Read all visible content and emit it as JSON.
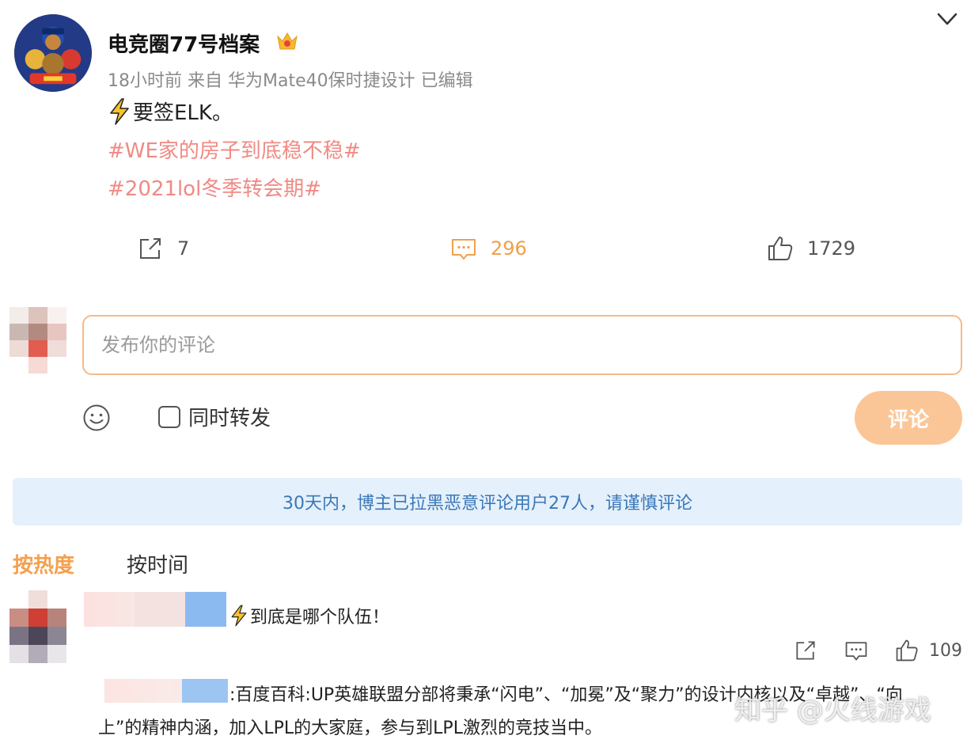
{
  "post": {
    "author": "电竞圈77号档案",
    "time": "18小时前",
    "source_prefix": "来自",
    "source": "华为Mate40保时捷设计",
    "edited": "已编辑",
    "text": "要签ELK。",
    "hashtags": [
      "#WE家的房子到底稳不稳#",
      "#2021lol冬季转会期#"
    ],
    "stats": {
      "shares": "7",
      "comments": "296",
      "likes": "1729"
    }
  },
  "comment_box": {
    "placeholder": "发布你的评论",
    "repost_label": "同时转发",
    "submit_label": "评论"
  },
  "notice": "30天内，博主已拉黑恶意评论用户27人，请谨慎评论",
  "sort": {
    "hot": "按热度",
    "time": "按时间"
  },
  "comments": [
    {
      "text": "到底是哪个队伍！",
      "likes": "109",
      "reply_line_1": ":百度百科:UP英雄联盟分部将秉承“闪电”、“加冕”及“聚力”的设计内核以及“卓越”、“向",
      "reply_line_2": "上”的精神内涵，加入LPL的大家庭，参与到LPL激烈的竞技当中。"
    }
  ],
  "watermark": "知乎 @火线游戏",
  "icons": {
    "header": [
      "avatar-image",
      "crown-badge-icon",
      "chevron-down-icon",
      "lightning-icon"
    ],
    "actions": [
      "share-icon",
      "comment-icon",
      "like-icon"
    ],
    "composer": [
      "emoji-icon",
      "checkbox"
    ]
  },
  "colors": {
    "hashtag": "#f08a84",
    "accent_orange": "#f0a04b",
    "submit_button": "#fbc697",
    "notice_bg": "#e4f0fb",
    "notice_text": "#3b78b8"
  }
}
